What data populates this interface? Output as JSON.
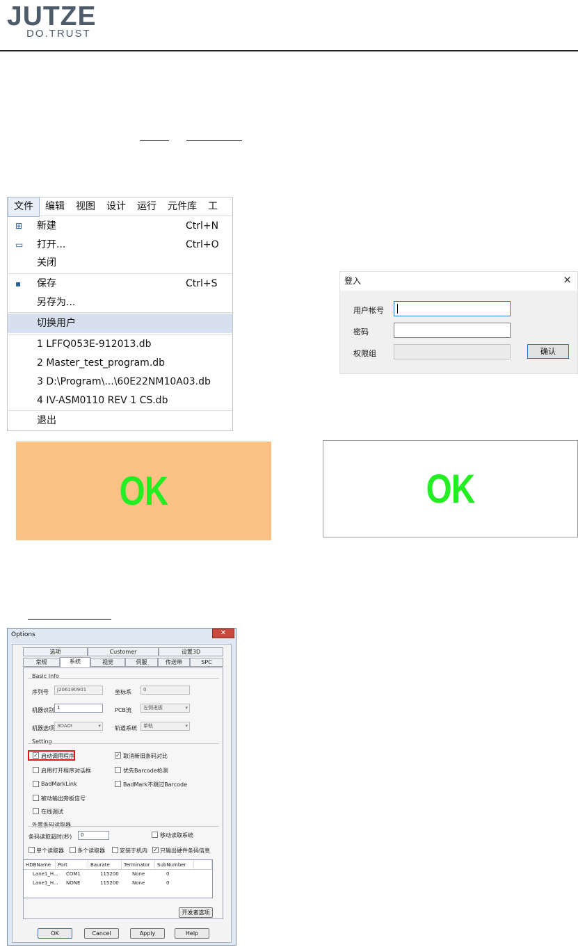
{
  "header": {
    "logo_main": "JUTZE",
    "logo_sub": "DO.TRUST"
  },
  "menu": {
    "menubar": [
      "文件",
      "编辑",
      "视图",
      "设计",
      "运行",
      "元件库",
      "工"
    ],
    "items": [
      {
        "label": "新建",
        "shortcut": "Ctrl+N",
        "icon": "new-file-icon"
      },
      {
        "label": "打开...",
        "shortcut": "Ctrl+O",
        "icon": "open-file-icon"
      },
      {
        "label": "关闭",
        "shortcut": ""
      },
      {
        "label": "保存",
        "shortcut": "Ctrl+S",
        "icon": "save-icon"
      },
      {
        "label": "另存为...",
        "shortcut": ""
      },
      {
        "label": "切换用户",
        "shortcut": "",
        "highlighted": true
      },
      {
        "label": "1 LFFQ053E-912013.db"
      },
      {
        "label": "2 Master_test_program.db"
      },
      {
        "label": "3 D:\\Program\\...\\60E22NM10A03.db"
      },
      {
        "label": "4 IV-ASM0110 REV 1 CS.db"
      },
      {
        "label": "退出"
      }
    ],
    "highlight_color": "#d6e0ee"
  },
  "login": {
    "title": "登入",
    "close": "×",
    "user_label": "用户帐号",
    "password_label": "密码",
    "group_label": "权限组",
    "confirm_label": "确认"
  },
  "ok_panels": {
    "left_text": "OK",
    "right_text": "OK",
    "left_bg": "#fcc185",
    "right_bg": "#ffffff",
    "text_color": "#22ee22"
  },
  "options": {
    "title": "Options",
    "close": "✕",
    "tabs_row1": [
      "选项",
      "Customer",
      "设置3D"
    ],
    "tabs_row2": [
      "常规",
      "系统",
      "视觉",
      "伺服",
      "传送带",
      "SPC"
    ],
    "active_tab": "系统",
    "basic_info_label": "Basic Info",
    "serial_label": "序列号",
    "serial_value": "J206190901",
    "coord_label": "坐标系",
    "coord_value": "0",
    "machine_id_label": "机器识别",
    "machine_id_value": "1",
    "pcb_flow_label": "PCB流",
    "pcb_flow_value": "左侧进板",
    "machine_option_label": "机器选项",
    "machine_option_value": "3DAOI",
    "track_label": "轨道系统",
    "track_value": "单轨",
    "setting_label": "Setting",
    "checks": [
      {
        "label": "启动调用程序",
        "checked": true
      },
      {
        "label": "取消新旧条码对比",
        "checked": true
      },
      {
        "label": "启用打开程序对话框",
        "checked": false
      },
      {
        "label": "优先Barcode检测",
        "checked": false
      },
      {
        "label": "BadMarkLink",
        "checked": false
      },
      {
        "label": "BadMark不跳过Barcode",
        "checked": false
      },
      {
        "label": "被动输出旁板信号",
        "checked": false
      },
      {
        "label": "在线调试",
        "checked": false
      }
    ],
    "barcode_group_label": "外置条码读取器",
    "timeout_label": "条码读取超时(秒)",
    "timeout_value": "0",
    "mobile_read_label": "移动读取系统",
    "reader_opts": [
      {
        "label": "单个读取器",
        "checked": false
      },
      {
        "label": "多个读取器",
        "checked": false
      },
      {
        "label": "安装于机内",
        "checked": false
      },
      {
        "label": "只输出硬件条码信息",
        "checked": true
      }
    ],
    "table_headers": [
      "HDBName",
      "Port",
      "Baurate",
      "Terminator",
      "SubNumber"
    ],
    "table_rows": [
      [
        "Lane1_H...",
        "COM1",
        "115200",
        "None",
        "0"
      ],
      [
        "Lane1_H...",
        "NONE",
        "115200",
        "None",
        "0"
      ]
    ],
    "advanced_label": "开发者选项",
    "buttons": {
      "ok": "OK",
      "cancel": "Cancel",
      "apply": "Apply",
      "help": "Help"
    }
  }
}
